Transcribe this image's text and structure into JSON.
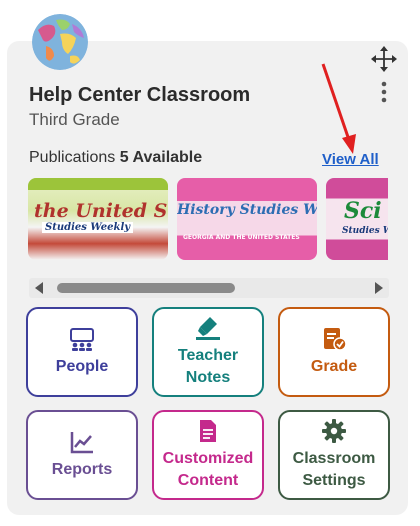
{
  "classroom": {
    "title": "Help Center Classroom",
    "grade": "Third Grade"
  },
  "publications": {
    "label": "Publications",
    "count_text": "5 Available",
    "view_all": "View All",
    "items": [
      {
        "title": "the United States",
        "subtitle": "Studies Weekly"
      },
      {
        "title": "History Studies Weekly",
        "subtitle": "GEORGIA AND THE UNITED STATES"
      },
      {
        "title": "Sci",
        "subtitle": "Studies Weekly"
      }
    ]
  },
  "tiles": {
    "people": {
      "label": "People",
      "color": "#3e3f9b"
    },
    "teacher_notes": {
      "label": "Teacher Notes",
      "color": "#15807d"
    },
    "grade": {
      "label": "Grade",
      "color": "#c45b10"
    },
    "reports": {
      "label": "Reports",
      "color": "#6a4f93"
    },
    "customized_content": {
      "label": "Customized Content",
      "color": "#c4298c"
    },
    "classroom_settings": {
      "label": "Classroom Settings",
      "color": "#3d5a43"
    }
  },
  "icons": [
    "globe-icon",
    "move-icon",
    "kebab-menu-icon",
    "people-icon",
    "highlighter-icon",
    "grade-icon",
    "chart-icon",
    "document-icon",
    "gear-icon"
  ],
  "annotation_arrow_color": "#e02020"
}
